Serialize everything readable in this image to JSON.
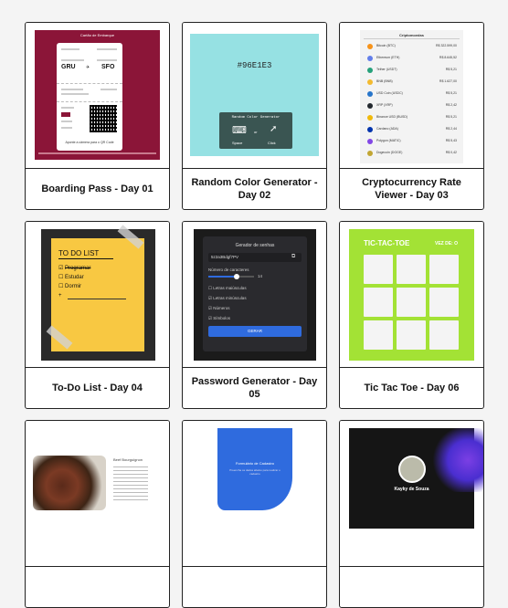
{
  "cards": [
    {
      "title": "Boarding Pass - Day 01"
    },
    {
      "title": "Random Color Generator - Day 02"
    },
    {
      "title": "Cryptocurrency Rate Viewer - Day 03"
    },
    {
      "title": "To-Do List - Day 04"
    },
    {
      "title": "Password Generator - Day 05"
    },
    {
      "title": "Tic Tac Toe - Day 06"
    },
    {
      "title": ""
    },
    {
      "title": ""
    },
    {
      "title": ""
    }
  ],
  "boarding": {
    "header": "Cartão de Embarque",
    "from": "GRU",
    "to": "SFO",
    "footer": "Aponte a câmera para o QR Code"
  },
  "color_gen": {
    "hex": "#96E1E3",
    "panel_title": "Random Color Generator",
    "space_label": "Space",
    "or_label": "or",
    "click_label": "Click",
    "color": "#96e1e3"
  },
  "crypto": {
    "header": "Criptomoedas",
    "coins": [
      {
        "name": "Bitcoin (BTC)",
        "value": "R$ 322.599,00",
        "color": "#f7931a"
      },
      {
        "name": "Ethereum (ETH)",
        "value": "R$ 8.645,52",
        "color": "#627eea"
      },
      {
        "name": "Tether (USDT)",
        "value": "R$ 5,21",
        "color": "#26a17b"
      },
      {
        "name": "BNB (BNB)",
        "value": "R$ 1.627,00",
        "color": "#f3ba2f"
      },
      {
        "name": "USD Coin (USDC)",
        "value": "R$ 5,21",
        "color": "#2775ca"
      },
      {
        "name": "XRP (XRP)",
        "value": "R$ 2,42",
        "color": "#23292f"
      },
      {
        "name": "Binance USD (BUSD)",
        "value": "R$ 5,21",
        "color": "#f0b90b"
      },
      {
        "name": "Cardano (ADA)",
        "value": "R$ 2,44",
        "color": "#0033ad"
      },
      {
        "name": "Polygon (MATIC)",
        "value": "R$ 5,43",
        "color": "#8247e5"
      },
      {
        "name": "Dogecoin (DOGE)",
        "value": "R$ 0,42",
        "color": "#c2a633"
      }
    ]
  },
  "todo": {
    "heading": "TO DO LIST",
    "items": [
      "Programar",
      "Estudar",
      "Dormir"
    ]
  },
  "password": {
    "heading": "Gerador de senhas",
    "value": "5z2a3Bdgf7PV",
    "length_label": "Número de caracteres",
    "length_value": "14",
    "options": [
      "Letras maiúsculas",
      "Letras minúsculas",
      "Números",
      "Símbolos"
    ],
    "button": "GERAR"
  },
  "ttt": {
    "title": "TIC-TAC-TOE",
    "turn": "VEZ DE: O"
  },
  "recipe": {
    "title": "Beef Bourguignon"
  },
  "form": {
    "title": "Formulário de Cadastro",
    "subtitle": "Preencha os dados abaixo para realizar o cadastro"
  },
  "profile": {
    "name": "Kayky de Souza"
  }
}
